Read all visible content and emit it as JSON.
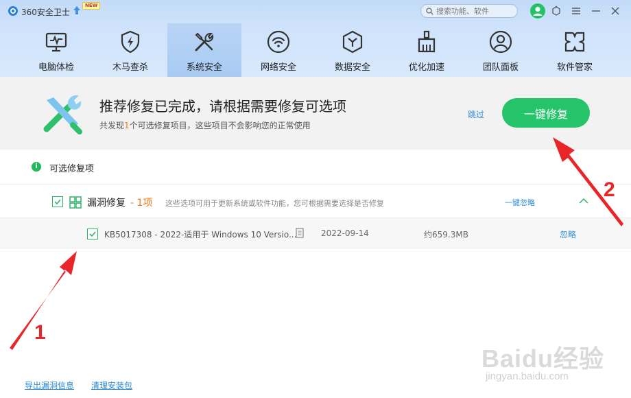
{
  "app": {
    "title": "360安全卫士",
    "new_badge": "NEW",
    "search_placeholder": "搜索功能、软件"
  },
  "nav": {
    "items": [
      {
        "label": "电脑体检",
        "icon": "monitor-icon"
      },
      {
        "label": "木马查杀",
        "icon": "shield-bolt-icon"
      },
      {
        "label": "系统安全",
        "icon": "tools-icon",
        "active": true
      },
      {
        "label": "网络安全",
        "icon": "wifi-icon"
      },
      {
        "label": "数据安全",
        "icon": "cube-icon"
      },
      {
        "label": "优化加速",
        "icon": "broom-icon"
      },
      {
        "label": "团队面板",
        "icon": "user-circle-icon"
      },
      {
        "label": "软件管家",
        "icon": "apps-icon"
      }
    ]
  },
  "banner": {
    "title": "推荐修复已完成，请根据需要修复可选项",
    "subtitle_prefix": "共发现",
    "subtitle_count": "1",
    "subtitle_suffix": "个可选修复项目，这些项目不会影响您的正常使用",
    "skip_label": "跳过",
    "repair_label": "一键修复"
  },
  "optional": {
    "section_title": "可选修复项",
    "group": {
      "title": "漏洞修复",
      "count": " - 1项",
      "description": "这些选项可用于更新系统或软件功能，您可根据需要选择是否修复",
      "ignore_all_label": "一键忽略",
      "checked": true
    },
    "items": [
      {
        "name": "KB5017308 - 2022-适用于 Windows 10 Versio...",
        "date": "2022-09-14",
        "size": "约659.3MB",
        "ignore_label": "忽略",
        "checked": true
      }
    ]
  },
  "footer": {
    "export_label": "导出漏洞信息",
    "cleanup_label": "清理安装包"
  },
  "annotations": {
    "marker_1": "1",
    "marker_2": "2",
    "arrow_color": "#e8262a",
    "watermark": "Baidu经验",
    "watermark_url": "jingyan.baidu.com"
  },
  "colors": {
    "accent_green": "#25c46b",
    "link_blue": "#2c8ad8",
    "highlight_orange": "#f07a1a",
    "header_blue": "#c3dbf8"
  }
}
